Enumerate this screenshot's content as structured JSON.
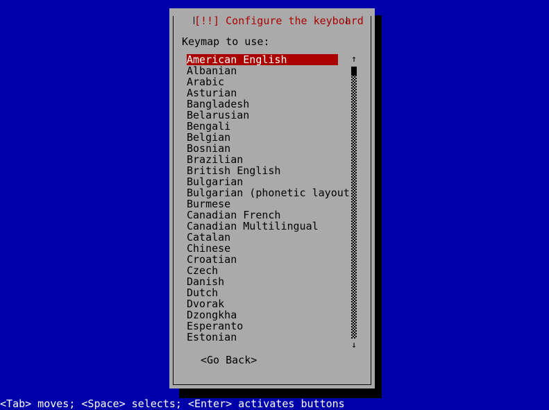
{
  "screen": {
    "background_color": "#0000aa",
    "dialog_background_color": "#aaaaaa",
    "title_color": "#aa0000",
    "highlight_background_color": "#aa0000",
    "highlight_text_color": "#ffffff",
    "text_color": "#000000"
  },
  "dialog": {
    "title": "[!!] Configure the keyboard",
    "prompt": "Keymap to use:"
  },
  "keymap_list": {
    "selected_index": 0,
    "items": [
      {
        "label": "American English"
      },
      {
        "label": "Albanian"
      },
      {
        "label": "Arabic"
      },
      {
        "label": "Asturian"
      },
      {
        "label": "Bangladesh"
      },
      {
        "label": "Belarusian"
      },
      {
        "label": "Bengali"
      },
      {
        "label": "Belgian"
      },
      {
        "label": "Bosnian"
      },
      {
        "label": "Brazilian"
      },
      {
        "label": "British English"
      },
      {
        "label": "Bulgarian"
      },
      {
        "label": "Bulgarian (phonetic layout)"
      },
      {
        "label": "Burmese"
      },
      {
        "label": "Canadian French"
      },
      {
        "label": "Canadian Multilingual"
      },
      {
        "label": "Catalan"
      },
      {
        "label": "Chinese"
      },
      {
        "label": "Croatian"
      },
      {
        "label": "Czech"
      },
      {
        "label": "Danish"
      },
      {
        "label": "Dutch"
      },
      {
        "label": "Dvorak"
      },
      {
        "label": "Dzongkha"
      },
      {
        "label": "Esperanto"
      },
      {
        "label": "Estonian"
      }
    ]
  },
  "scrollbar": {
    "up_arrow": "↑",
    "down_arrow": "↓"
  },
  "buttons": {
    "go_back": "<Go Back>"
  },
  "status_bar": {
    "text": "<Tab> moves; <Space> selects; <Enter> activates buttons"
  }
}
